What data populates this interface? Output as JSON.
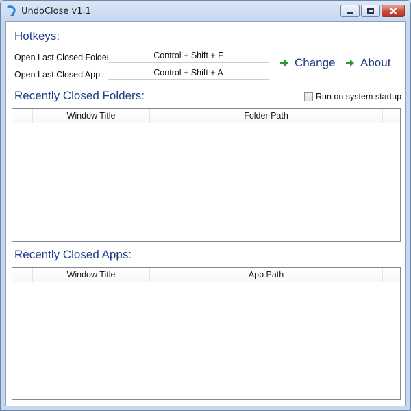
{
  "window": {
    "title": "UndoClose v1.1",
    "icon": "undo-arrow-icon"
  },
  "hotkeys": {
    "heading": "Hotkeys:",
    "folder_label": "Open Last Closed Folder",
    "folder_value": "Control + Shift + F",
    "app_label": "Open Last Closed App:",
    "app_value": "Control + Shift + A"
  },
  "actions": {
    "change_label": "Change",
    "about_label": "About",
    "arrow_icon": "green-arrow-icon",
    "arrow_color": "#2a9a2a"
  },
  "startup": {
    "label": "Run on system startup",
    "checked": false
  },
  "folders": {
    "heading": "Recently Closed Folders:",
    "columns": [
      "",
      "Window Title",
      "Folder Path",
      ""
    ],
    "rows": []
  },
  "apps": {
    "heading": "Recently Closed Apps:",
    "columns": [
      "",
      "Window Title",
      "App Path",
      ""
    ],
    "rows": []
  },
  "colors": {
    "heading": "#1f3e8a",
    "frame": "#c6d8ef"
  }
}
